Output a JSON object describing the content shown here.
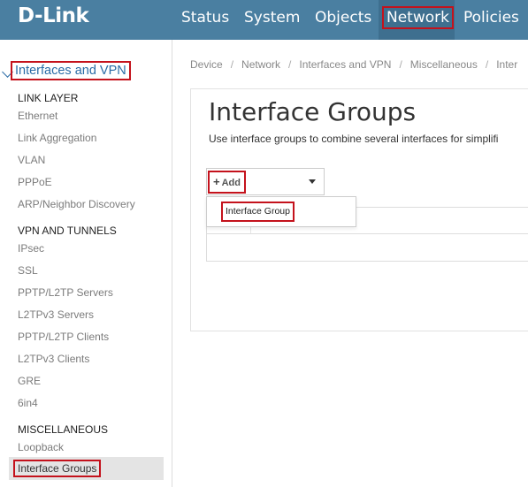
{
  "brand": {
    "logo": "D-Link"
  },
  "topnav": {
    "items": [
      {
        "label": "Status"
      },
      {
        "label": "System"
      },
      {
        "label": "Objects"
      },
      {
        "label": "Network"
      },
      {
        "label": "Policies"
      }
    ],
    "active": "Network"
  },
  "sidebar": {
    "section_title": "Interfaces and VPN",
    "groups": [
      {
        "heading": "LINK LAYER",
        "items": [
          "Ethernet",
          "Link Aggregation",
          "VLAN",
          "PPPoE",
          "ARP/Neighbor Discovery"
        ]
      },
      {
        "heading": "VPN AND TUNNELS",
        "items": [
          "IPsec",
          "SSL",
          "PPTP/L2TP Servers",
          "L2TPv3 Servers",
          "PPTP/L2TP Clients",
          "L2TPv3 Clients",
          "GRE",
          "6in4"
        ]
      },
      {
        "heading": "MISCELLANEOUS",
        "items": [
          "Loopback",
          "Interface Groups"
        ]
      }
    ],
    "active_item": "Interface Groups"
  },
  "breadcrumb": [
    "Device",
    "Network",
    "Interfaces and VPN",
    "Miscellaneous",
    "Inter"
  ],
  "main": {
    "title": "Interface Groups",
    "description": "Use interface groups to combine several interfaces for simplifi",
    "add_button": {
      "icon": "plus-icon",
      "label": "Add"
    },
    "dropdown": {
      "items": [
        "Interface Group"
      ]
    }
  },
  "colors": {
    "topbar": "#4a7fa1",
    "accent": "#2a6ca6",
    "highlight": "#c4121c"
  }
}
